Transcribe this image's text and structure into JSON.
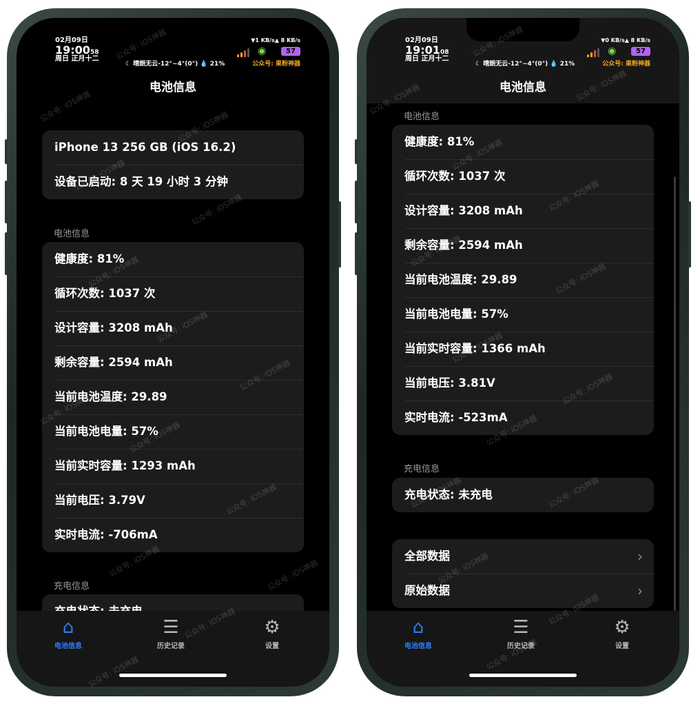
{
  "left": {
    "status": {
      "date": "02月09日",
      "time": "19:00",
      "seconds": "58",
      "lunar": "周日 正月十二",
      "weather": "☾ 晴朗无云-12°~4°(0°) 💧 21%",
      "net": "▼1 KB/s▲ 8 KB/s",
      "battery": "57",
      "gzh": "公众号: 果粉神器"
    },
    "nav_title": "电池信息",
    "device": {
      "model": "iPhone 13 256 GB (iOS 16.2)",
      "uptime": "设备已启动:  8 天 19 小时 3 分钟"
    },
    "battery_section_label": "电池信息",
    "battery_rows": [
      "健康度: 81%",
      "循环次数: 1037 次",
      "设计容量: 3208 mAh",
      "剩余容量: 2594 mAh",
      "当前电池温度: 29.89",
      "当前电池电量: 57%",
      "当前实时容量: 1293 mAh",
      "当前电压: 3.79V",
      "实时电流: -706mA"
    ],
    "charge_section_label": "充电信息",
    "charge_rows": [
      "充电状态: 未充电"
    ]
  },
  "right": {
    "status": {
      "date": "02月09日",
      "time": "19:01",
      "seconds": "08",
      "lunar": "周日 正月十二",
      "weather": "☾ 晴朗无云-12°~4°(0°) 💧 21%",
      "net": "▼0 KB/s▲ 8 KB/s",
      "battery": "57",
      "gzh": "公众号: 果粉神器"
    },
    "nav_title": "电池信息",
    "battery_section_label": "电池信息",
    "battery_rows": [
      "健康度: 81%",
      "循环次数: 1037 次",
      "设计容量: 3208 mAh",
      "剩余容量: 2594 mAh",
      "当前电池温度: 29.89",
      "当前电池电量: 57%",
      "当前实时容量: 1366 mAh",
      "当前电压: 3.81V",
      "实时电流: -523mA"
    ],
    "charge_section_label": "充电信息",
    "charge_rows": [
      "充电状态: 未充电"
    ],
    "data_rows": [
      "全部数据",
      "原始数据"
    ]
  },
  "tabbar": {
    "tabs": [
      {
        "label": "电池信息",
        "icon": "house-icon",
        "active": true
      },
      {
        "label": "历史记录",
        "icon": "list-icon",
        "active": false
      },
      {
        "label": "设置",
        "icon": "gear-icon",
        "active": false
      }
    ]
  },
  "watermark": "公众号: iOS神器",
  "colors": {
    "accent": "#2f7cf6",
    "background": "#000000",
    "card": "#1c1c1e",
    "section_label": "#9a9a9e",
    "battery_badge": "#b063f0",
    "wifi": "#7ed957",
    "gzh": "#f4a522"
  }
}
